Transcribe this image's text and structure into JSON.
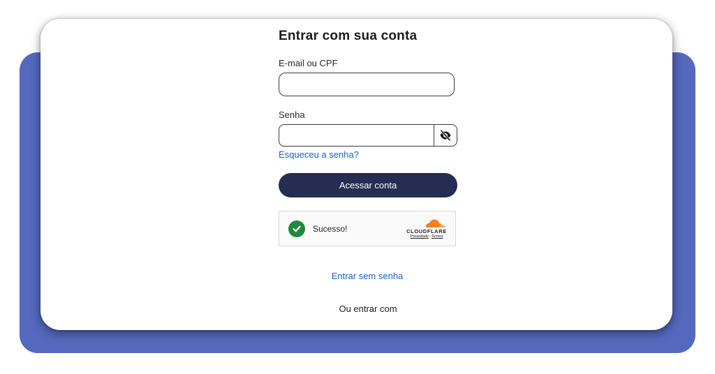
{
  "login": {
    "title": "Entrar com sua conta",
    "email_label": "E-mail ou CPF",
    "email_value": "",
    "password_label": "Senha",
    "password_value": "",
    "forgot_password": "Esqueceu a senha?",
    "submit_label": "Acessar conta",
    "passwordless_link": "Entrar sem senha",
    "or_text": "Ou entrar com"
  },
  "captcha": {
    "status": "Sucesso!",
    "brand": "CLOUDFLARE",
    "privacy_link": "Privacidade",
    "separator": "·",
    "terms_link": "Termos"
  },
  "icons": {
    "password_toggle": "eye-off-icon",
    "captcha_status": "check-circle-icon",
    "captcha_brand": "cloudflare-logo"
  },
  "colors": {
    "backdrop": "#5468bd",
    "primary_button": "#252d52",
    "link": "#1a62c4",
    "success": "#1f8a3b",
    "cloudflare_orange": "#f38020"
  }
}
